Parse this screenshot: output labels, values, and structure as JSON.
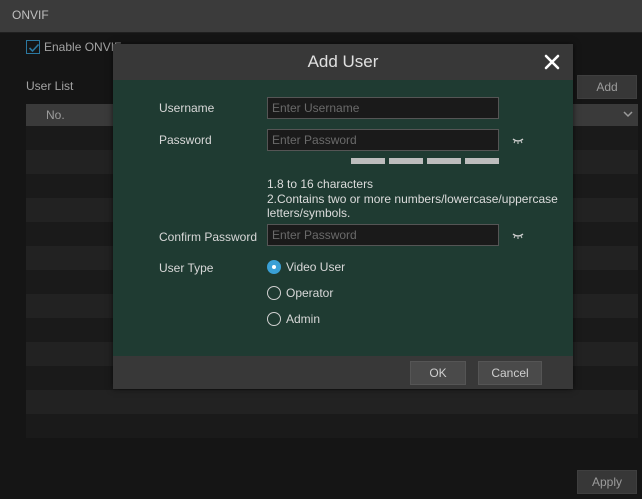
{
  "window": {
    "title": "ONVIF"
  },
  "onvif": {
    "enable_label": "Enable ONVIF",
    "enabled": true
  },
  "user_list": {
    "label": "User List",
    "add_label": "Add",
    "columns": [
      "No."
    ],
    "rows": 12
  },
  "footer": {
    "apply_label": "Apply"
  },
  "modal": {
    "title": "Add User",
    "username_label": "Username",
    "username_placeholder": "Enter Username",
    "password_label": "Password",
    "password_placeholder": "Enter Password",
    "hint_line1": "1.8 to 16 characters",
    "hint_line2": "2.Contains two or more numbers/lowercase/uppercase",
    "hint_line3": "letters/symbols.",
    "confirm_label": "Confirm Password",
    "confirm_placeholder": "Enter Password",
    "user_type_label": "User Type",
    "user_types": [
      {
        "label": "Video User",
        "selected": true
      },
      {
        "label": "Operator",
        "selected": false
      },
      {
        "label": "Admin",
        "selected": false
      }
    ],
    "ok_label": "OK",
    "cancel_label": "Cancel"
  },
  "colors": {
    "accent": "#3aa0d6",
    "modal_bg": "#1f3b32"
  },
  "icons": [
    "checkbox-check-icon",
    "chevron-down-icon",
    "close-icon",
    "eye-icon"
  ]
}
